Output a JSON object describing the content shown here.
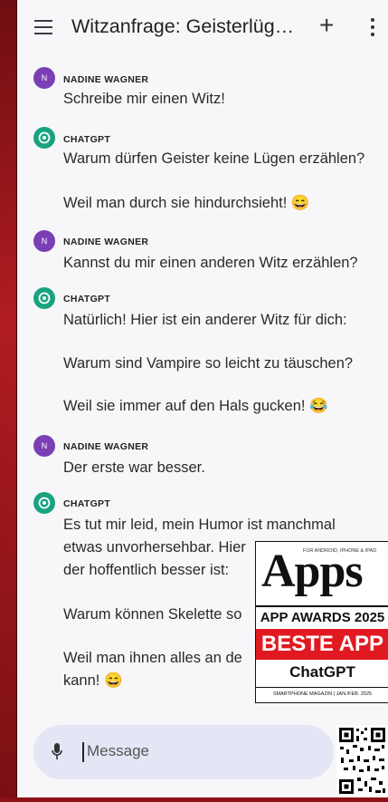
{
  "window": {
    "title": "Witzanfrage: Geisterlüg…"
  },
  "icons": {
    "menu": "hamburger-menu-icon",
    "new_chat": "plus-icon",
    "more": "more-vert-icon",
    "mic": "microphone-icon",
    "chatgpt": "chatgpt-logo-icon"
  },
  "colors": {
    "user_avatar": "#7b3fb5",
    "bot_avatar": "#19a37f",
    "input_bg": "#e4e6f5",
    "badge_red": "#e11a22"
  },
  "messages": [
    {
      "sender": "NADINE WAGNER",
      "avatar": "N",
      "lines": [
        "Schreibe mir einen Witz!"
      ]
    },
    {
      "sender": "CHATGPT",
      "lines": [
        "Warum dürfen Geister keine Lügen erzählen?",
        "",
        "Weil man durch sie hindurchsieht! 😄"
      ]
    },
    {
      "sender": "NADINE WAGNER",
      "avatar": "N",
      "lines": [
        "Kannst du mir einen anderen Witz erzählen?"
      ]
    },
    {
      "sender": "CHATGPT",
      "lines": [
        "Natürlich! Hier ist ein anderer Witz für dich:",
        "",
        "Warum sind Vampire so leicht zu täuschen?",
        "",
        "Weil sie immer auf den Hals gucken! 😂"
      ]
    },
    {
      "sender": "NADINE WAGNER",
      "avatar": "N",
      "lines": [
        "Der erste war besser."
      ]
    },
    {
      "sender": "CHATGPT",
      "lines": [
        "Es tut mir leid, mein Humor ist manchmal",
        "etwas unvorhersehbar. Hier",
        "der hoffentlich besser ist:",
        "",
        "Warum können Skelette so",
        "",
        "Weil man ihnen alles an de",
        "kann! 😄"
      ]
    }
  ],
  "input": {
    "placeholder": "Message"
  },
  "badge": {
    "small": "FÜR ANDROID, IPHONE & IPAD",
    "logo": "Apps",
    "awards": "APP AWARDS 2025",
    "best": "BESTE APP",
    "product": "ChatGPT",
    "magazine": "SMARTPHONE MAGAZIN | JAN./FEB. 2025"
  }
}
